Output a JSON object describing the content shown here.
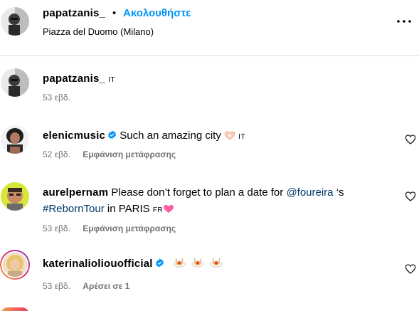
{
  "header": {
    "username": "papatzanis_",
    "separator": "•",
    "follow_label": "Ακολουθήστε",
    "location": "Piazza del Duomo (Milano)"
  },
  "caption": {
    "username": "papatzanis_",
    "lang": "IT",
    "time": "53 εβδ."
  },
  "comments": [
    {
      "username": "elenicmusic",
      "verified": true,
      "text": "Such an amazing city",
      "emoji": "🫶🏻",
      "lang": "IT",
      "time": "52 εβδ.",
      "action": "Εμφάνιση μετάφρασης"
    },
    {
      "username": "aurelpernam",
      "verified": false,
      "text_before": "Please don’t forget to plan a date for",
      "mention": "@foureira",
      "text_after": "‘s",
      "hashtag": "#RebornTour",
      "text_end": "in PARIS",
      "lang": "FR",
      "time": "53 εβδ.",
      "action": "Εμφάνιση μετάφρασης"
    },
    {
      "username": "katerinalioliouofficial",
      "verified": true,
      "emoji_count": 3,
      "time": "53 εβδ.",
      "action": "Αρέσει σε 1"
    }
  ],
  "icons": {
    "more": "more-horizontal-icon",
    "heart": "heart-outline-icon",
    "verified": "verified-badge-icon"
  },
  "colors": {
    "link_blue": "#0095f6",
    "mention_blue": "#00376b",
    "meta_gray": "#737373",
    "verified_blue": "#0095f6"
  }
}
